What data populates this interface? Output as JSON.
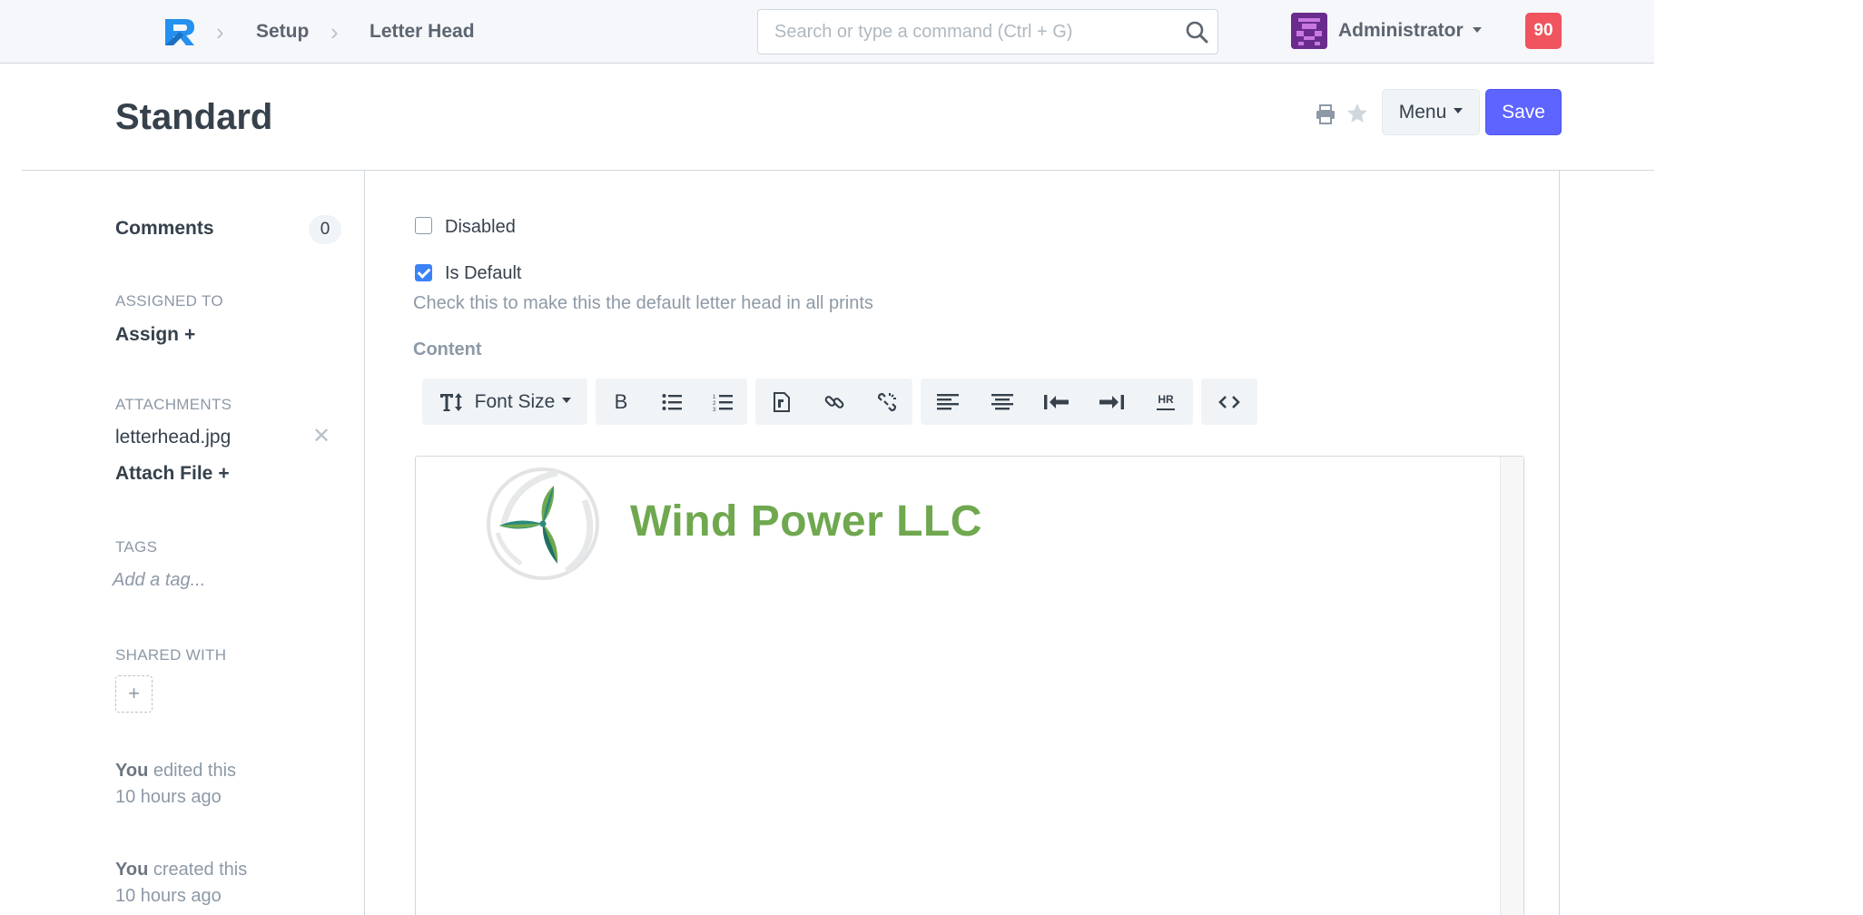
{
  "navbar": {
    "breadcrumbs": [
      "Setup",
      "Letter Head"
    ],
    "search_placeholder": "Search or type a command (Ctrl + G)",
    "user_name": "Administrator",
    "notification_count": "90"
  },
  "page": {
    "title": "Standard",
    "menu_label": "Menu",
    "save_label": "Save"
  },
  "sidebar": {
    "comments_label": "Comments",
    "comments_count": "0",
    "assigned_to_label": "ASSIGNED TO",
    "assign_label": "Assign",
    "attachments_label": "ATTACHMENTS",
    "attachment_file": "letterhead.jpg",
    "remove_glyph": "✕",
    "attach_file_label": "Attach File",
    "plus_glyph": "+",
    "tags_label": "TAGS",
    "tag_placeholder": "Add a tag...",
    "shared_with_label": "SHARED WITH",
    "timeline": [
      {
        "who": "You",
        "action": " edited this",
        "when": "10 hours ago"
      },
      {
        "who": "You",
        "action": " created this",
        "when": "10 hours ago"
      }
    ]
  },
  "form": {
    "disabled_label": "Disabled",
    "disabled_checked": false,
    "is_default_label": "Is Default",
    "is_default_checked": true,
    "is_default_help": "Check this to make this the default letter head in all prints",
    "content_label": "Content",
    "toolbar": {
      "font_size_label": "Font Size",
      "bold_label": "B",
      "hr_label": "HR"
    }
  },
  "letterhead": {
    "company_name": "Wind Power LLC",
    "brand_color": "#6fa84f"
  },
  "colors": {
    "primary": "#5e64ff",
    "notification": "#f0545f",
    "logo_blue": "#2490ef"
  }
}
